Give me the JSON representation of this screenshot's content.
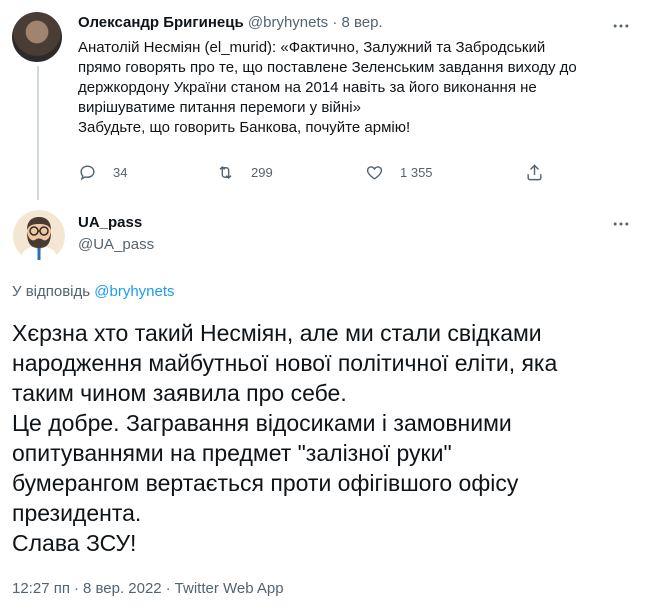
{
  "parent_tweet": {
    "author_name": "Олександр Бригинець",
    "author_handle": "@bryhynets",
    "separator": "·",
    "date": "8 вер.",
    "text_lines": [
      "Анатолій Несміян (el_murid): «Фактично, Залужний та Забродський",
      "прямо говорять про те, що поставлене Зеленським завдання виходу до",
      "держкордону України станом на 2014 навіть за його виконання не",
      "вирішуватиме питання перемоги у війні»",
      "Забудьте, що говорить Банкова, почуйте армію!"
    ],
    "actions": {
      "replies": "34",
      "retweets": "299",
      "likes": "1 355"
    },
    "more_icon": "more-horizontal-icon"
  },
  "reply_tweet": {
    "author_name": "UA_pass",
    "author_handle": "@UA_pass",
    "reply_prefix": "У відповідь",
    "reply_to_handle": "@bryhynets",
    "text_lines": [
      "Хєрзна хто такий Несміян, але ми стали свідками",
      "народження майбутньої нової політичної еліти, яка",
      "таким чином заявила про себе.",
      "Це добре. Загравання відосиками і замовними",
      "опитуваннями на предмет \"залізної руки\"",
      "бумерангом вертається проти офігівшого офісу",
      "президента.",
      "Слава ЗСУ!"
    ],
    "time": "12:27 пп",
    "date": "8 вер. 2022",
    "source": "Twitter Web App",
    "separator": "·"
  },
  "colors": {
    "text": "#0f1419",
    "secondary": "#536471",
    "link": "#1d9bf0",
    "thread_line": "#cfd9de"
  }
}
